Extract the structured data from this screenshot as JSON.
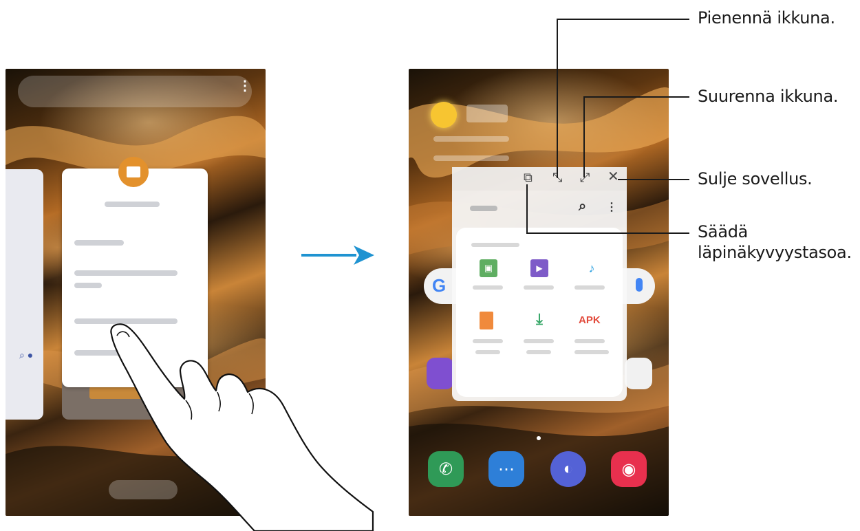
{
  "callouts": {
    "minimize": "Pienennä ikkuna.",
    "maximize": "Suurenna ikkuna.",
    "close": "Sulje sovellus.",
    "opacity_line1": "Säädä",
    "opacity_line2": "läpinäkyvyystasoa."
  },
  "popup_window": {
    "category_apk": "APK"
  },
  "colors": {
    "arrow": "#1f93d1",
    "folder_icon": "#e3912c",
    "phone_dock": [
      "#2f9a57",
      "#2e7fd8",
      "#5462d6",
      "#e8304e"
    ]
  },
  "icons": {
    "transparency": "transparency-icon",
    "minimize": "minimize-icon",
    "maximize": "maximize-icon",
    "close": "close-icon"
  }
}
